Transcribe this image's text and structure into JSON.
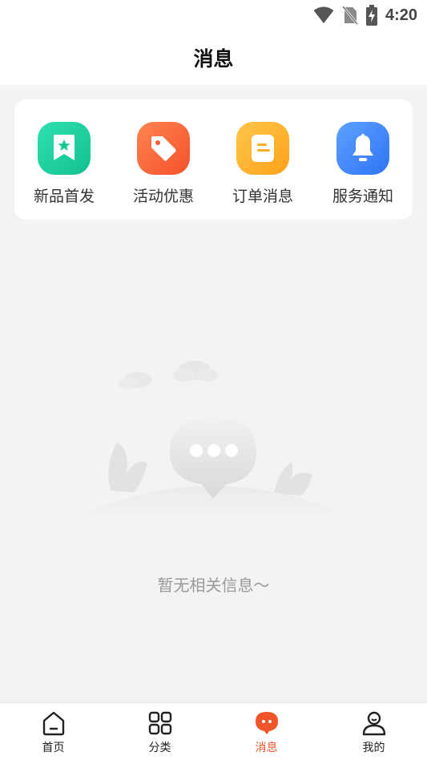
{
  "status_bar": {
    "time": "4:20"
  },
  "header": {
    "title": "消息"
  },
  "categories": [
    {
      "label": "新品首发",
      "icon": "bookmark-star-icon",
      "color": "#1ccf9c"
    },
    {
      "label": "活动优惠",
      "icon": "tag-icon",
      "color": "#ff6a3c"
    },
    {
      "label": "订单消息",
      "icon": "document-icon",
      "color": "#ffb12e"
    },
    {
      "label": "服务通知",
      "icon": "bell-icon",
      "color": "#3d86ff"
    }
  ],
  "empty_state": {
    "text": "暂无相关信息～"
  },
  "tabbar": {
    "active_color": "#f0542b",
    "items": [
      {
        "label": "首页",
        "icon": "home-icon"
      },
      {
        "label": "分类",
        "icon": "grid-icon"
      },
      {
        "label": "消息",
        "icon": "message-icon",
        "active": true
      },
      {
        "label": "我的",
        "icon": "profile-icon"
      }
    ]
  }
}
